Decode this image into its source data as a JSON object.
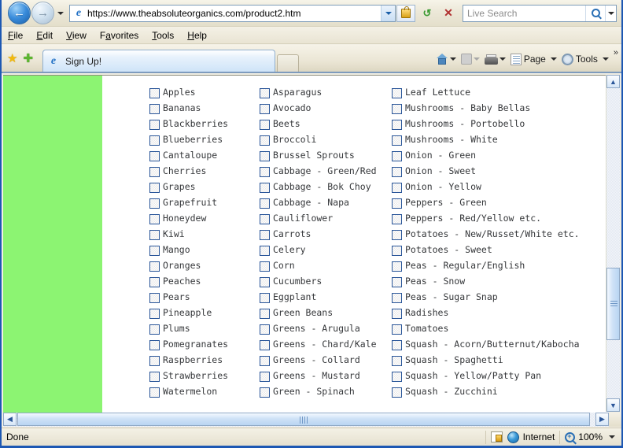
{
  "browser": {
    "url": "https://www.theabsoluteorganics.com/product2.htm",
    "search_placeholder": "Live Search",
    "back_icon": "back-arrow-icon",
    "forward_icon": "forward-arrow-icon",
    "lock_icon": "ssl-lock-icon",
    "refresh_icon": "refresh-icon",
    "stop_icon": "stop-icon",
    "search_icon": "search-magnifier-icon"
  },
  "menu": {
    "items": [
      {
        "label": "File",
        "accel": "F"
      },
      {
        "label": "Edit",
        "accel": "E"
      },
      {
        "label": "View",
        "accel": "V"
      },
      {
        "label": "Favorites",
        "accel": "a"
      },
      {
        "label": "Tools",
        "accel": "T"
      },
      {
        "label": "Help",
        "accel": "H"
      }
    ]
  },
  "favorites_bar": {
    "favorites_star_icon": "star-icon",
    "add_favorite_icon": "add-to-favorites-icon"
  },
  "tabs": [
    {
      "label": "Sign Up!",
      "icon": "ie-page-icon",
      "active": true
    }
  ],
  "new_tab_label": "",
  "command_bar": {
    "home_label": "",
    "feeds_label": "",
    "print_label": "",
    "page_label": "Page",
    "tools_label": "Tools",
    "overflow_label": "»"
  },
  "page": {
    "sidebar_color": "#8cf472",
    "columns": [
      {
        "name": "fruit-column",
        "items": [
          "Apples",
          "Bananas",
          "Blackberries",
          "Blueberries",
          "Cantaloupe",
          "Cherries",
          "Grapes",
          "Grapefruit",
          "Honeydew",
          "Kiwi",
          "Mango",
          "Oranges",
          "Peaches",
          "Pears",
          "Pineapple",
          "Plums",
          "Pomegranates",
          "Raspberries",
          "Strawberries",
          "Watermelon"
        ]
      },
      {
        "name": "vegetable-column-a",
        "items": [
          "Asparagus",
          "Avocado",
          "Beets",
          "Broccoli",
          "Brussel Sprouts",
          "Cabbage - Green/Red",
          "Cabbage - Bok Choy",
          "Cabbage - Napa",
          "Cauliflower",
          "Carrots",
          "Celery",
          "Corn",
          "Cucumbers",
          "Eggplant",
          "Green Beans",
          "Greens - Arugula",
          "Greens - Chard/Kale",
          "Greens - Collard",
          "Greens - Mustard",
          "Green - Spinach"
        ]
      },
      {
        "name": "vegetable-column-b",
        "items": [
          "Leaf Lettuce",
          "Mushrooms - Baby Bellas",
          "Mushrooms - Portobello",
          "Mushrooms - White",
          "Onion - Green",
          "Onion - Sweet",
          "Onion - Yellow",
          "Peppers - Green",
          "Peppers - Red/Yellow etc.",
          "Potatoes - New/Russet/White etc.",
          "Potatoes - Sweet",
          "Peas - Regular/English",
          "Peas - Snow",
          "Peas - Sugar Snap",
          "Radishes",
          "Tomatoes",
          "Squash - Acorn/Butternut/Kabocha",
          "Squash - Spaghetti",
          "Squash - Yellow/Patty Pan",
          "Squash - Zucchini"
        ]
      }
    ]
  },
  "status_bar": {
    "message": "Done",
    "zone": "Internet",
    "zone_icon": "security-zone-icon",
    "globe_icon": "internet-globe-icon",
    "zoom_level": "100%",
    "zoom_icon": "zoom-magnifier-icon"
  },
  "scrollbars": {
    "vertical_up": "▲",
    "vertical_down": "▼",
    "horizontal_left": "◀",
    "horizontal_right": "▶"
  }
}
